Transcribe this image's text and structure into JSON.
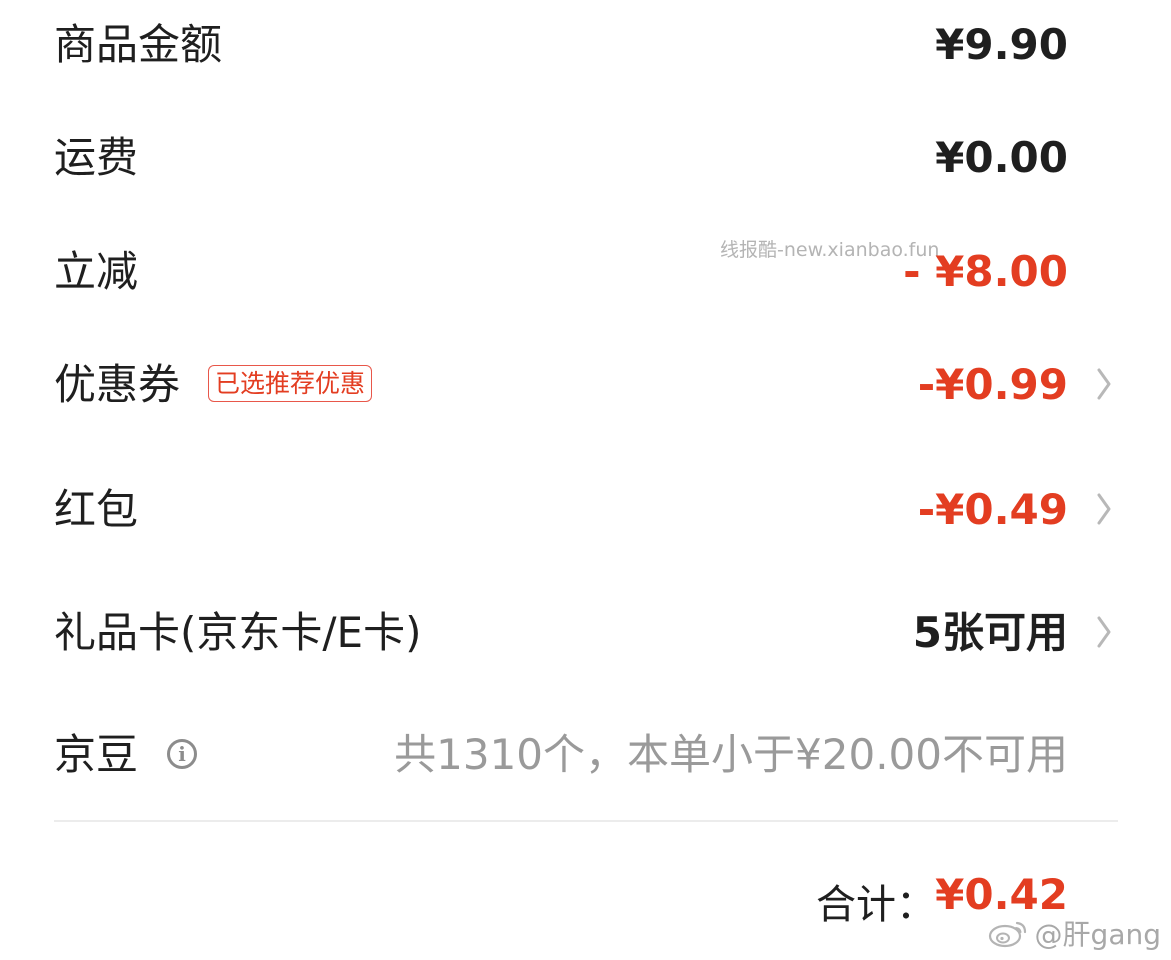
{
  "rows": [
    {
      "label": "商品金额",
      "value": "¥9.90"
    },
    {
      "label": "运费",
      "value": "¥0.00"
    },
    {
      "label": "立减",
      "value": "- ¥8.00"
    },
    {
      "label": "优惠券",
      "tag": "已选推荐优惠",
      "value": "-¥0.99"
    },
    {
      "label": "红包",
      "value": "-¥0.49"
    },
    {
      "label": "礼品卡(京东卡/E卡)",
      "value": "5张可用"
    },
    {
      "label": "京豆",
      "info_icon": "i",
      "value": "共1310个，本单小于¥20.00不可用"
    }
  ],
  "total": {
    "label": "合计：",
    "value": "¥0.42"
  },
  "watermark": "线报酷-new.xianbao.fun",
  "weibo": "@肝gang",
  "colors": {
    "red": "#e33d21",
    "text": "#1f1f1f",
    "grey": "#9a9a9a"
  },
  "icons": {
    "chevron": "chevron-right-icon",
    "info": "info-circle-icon",
    "weibo": "weibo-logo-icon"
  }
}
